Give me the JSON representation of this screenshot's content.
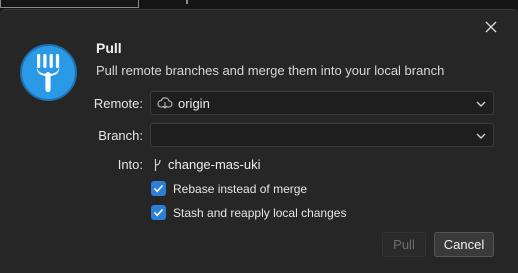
{
  "dialog": {
    "title": "Pull",
    "subtitle": "Pull remote branches and merge them into your local branch"
  },
  "form": {
    "remote_label": "Remote:",
    "remote_value": "origin",
    "branch_label": "Branch:",
    "branch_value": "",
    "into_label": "Into:",
    "into_value": "change-mas-uki"
  },
  "options": {
    "rebase_label": "Rebase instead of merge",
    "rebase_checked": true,
    "stash_label": "Stash and reapply local changes",
    "stash_checked": true
  },
  "buttons": {
    "pull_label": "Pull",
    "pull_enabled": false,
    "cancel_label": "Cancel"
  },
  "icons": {
    "app_logo": "fork-logo-icon",
    "remote": "cloud-icon",
    "branch": "branch-icon",
    "close": "close-icon"
  },
  "colors": {
    "logo_blue": "#2b9ae6",
    "checkbox_blue": "#2d7fd6",
    "dialog_bg": "#262626"
  }
}
